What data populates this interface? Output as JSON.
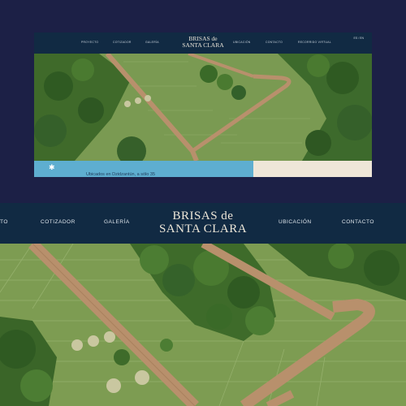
{
  "mockup": {
    "nav_items": [
      "PROYECTO",
      "COTIZADOR",
      "GALERÍA",
      "UBICACIÓN",
      "CONTACTO",
      "RECORRIDO VIRTUAL"
    ],
    "logo_line1": "BRISAS de",
    "logo_line2": "SANTA CLARA",
    "lang": "ES / EN",
    "band_text": "Ubicados en Dzidzantún, a sólo 35"
  },
  "header": {
    "nav_left": [
      "TO",
      "COTIZADOR",
      "GALERÍA"
    ],
    "nav_right": [
      "UBICACIÓN",
      "CONTACTO"
    ],
    "logo_line1": "BRISAS de",
    "logo_line2": "SANTA CLARA"
  },
  "colors": {
    "background": "#1c2046",
    "nav": "#112a43",
    "band": "#5eaed0",
    "lawn": "#7d9c52",
    "road": "#b8906c"
  }
}
